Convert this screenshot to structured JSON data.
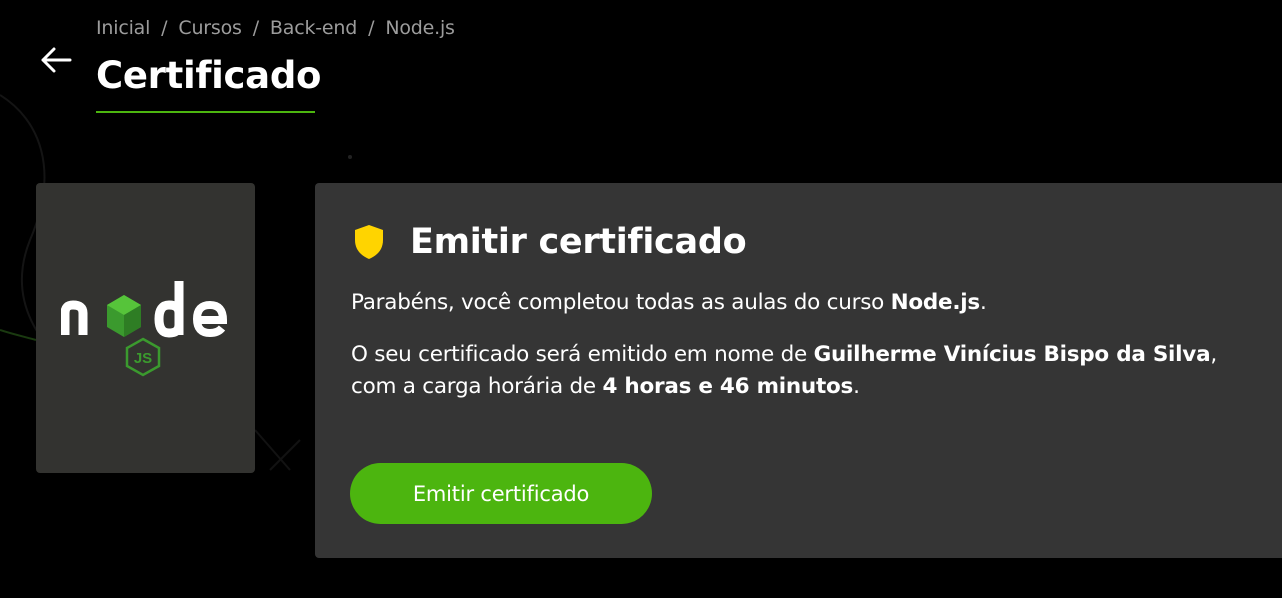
{
  "breadcrumb": {
    "items": [
      "Inicial",
      "Cursos",
      "Back-end",
      "Node.js"
    ],
    "separator": "/"
  },
  "header": {
    "back_icon": "arrow-left-icon",
    "title": "Certificado",
    "underline_color": "#4cb50f"
  },
  "course": {
    "logo_text": "node",
    "logo_badge": "JS"
  },
  "card": {
    "icon": "shield-icon",
    "icon_color": "#ffd400",
    "title": "Emitir certificado",
    "congrats_prefix": "Parabéns, você completou todas as aulas do curso ",
    "course_name": "Node.js",
    "congrats_suffix": ".",
    "issue_prefix": "O seu certificado será emitido em nome de ",
    "student_name": "Guilherme Vinícius Bispo da Silva",
    "issue_comma": ",",
    "workload_prefix": "com a carga horária de ",
    "workload": "4 horas e 46 minutos",
    "workload_suffix": ".",
    "button_label": "Emitir certificado",
    "accent_color": "#4cb50f"
  }
}
